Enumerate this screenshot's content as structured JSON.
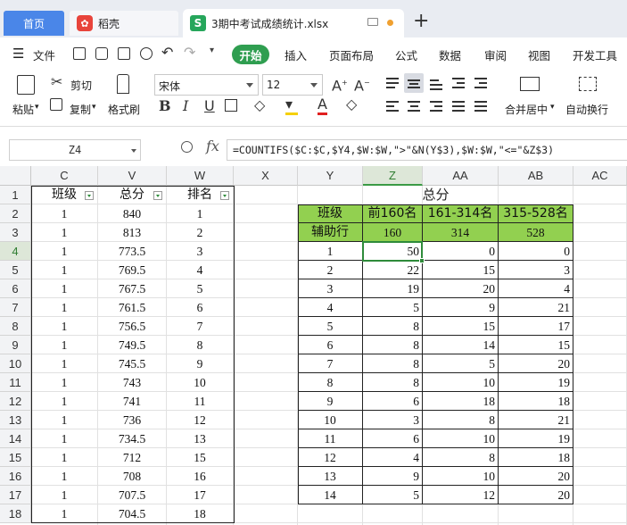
{
  "tabs": {
    "home": "首页",
    "docer": "稻壳",
    "file": "3期中考试成绩统计.xlsx",
    "new_tab": "+"
  },
  "menu": {
    "file": "文件",
    "start": "开始",
    "insert": "插入",
    "page_layout": "页面布局",
    "formula": "公式",
    "data": "数据",
    "review": "审阅",
    "view": "视图",
    "dev_tools": "开发工具"
  },
  "ribbon": {
    "paste": "粘贴",
    "cut": "剪切",
    "copy": "复制",
    "format_painter": "格式刷",
    "font_name": "宋体",
    "font_size": "12",
    "merge_center": "合并居中",
    "wrap_text": "自动换行",
    "bold": "B",
    "italic": "I",
    "underline": "U"
  },
  "formula_bar": {
    "name_box": "Z4",
    "fx": "fx",
    "formula": "=COUNTIFS($C:$C,$Y4,$W:$W,\">\"&N(Y$3),$W:$W,\"<=\"&Z$3)"
  },
  "columns": [
    "C",
    "V",
    "W",
    "X",
    "Y",
    "Z",
    "AA",
    "AB",
    "AC"
  ],
  "rows": [
    "1",
    "2",
    "3",
    "4",
    "5",
    "6",
    "7",
    "8",
    "9",
    "10",
    "11",
    "12",
    "13",
    "14",
    "15",
    "16",
    "17",
    "18"
  ],
  "left_table": {
    "headers": [
      "班级",
      "总分",
      "排名"
    ],
    "data": [
      [
        "1",
        "840",
        "1"
      ],
      [
        "1",
        "813",
        "2"
      ],
      [
        "1",
        "773.5",
        "3"
      ],
      [
        "1",
        "769.5",
        "4"
      ],
      [
        "1",
        "767.5",
        "5"
      ],
      [
        "1",
        "761.5",
        "6"
      ],
      [
        "1",
        "756.5",
        "7"
      ],
      [
        "1",
        "749.5",
        "8"
      ],
      [
        "1",
        "745.5",
        "9"
      ],
      [
        "1",
        "743",
        "10"
      ],
      [
        "1",
        "741",
        "11"
      ],
      [
        "1",
        "736",
        "12"
      ],
      [
        "1",
        "734.5",
        "13"
      ],
      [
        "1",
        "712",
        "15"
      ],
      [
        "1",
        "708",
        "16"
      ],
      [
        "1",
        "707.5",
        "17"
      ],
      [
        "1",
        "704.5",
        "18"
      ]
    ]
  },
  "stats_table": {
    "title": "总分",
    "headers": [
      "班级",
      "前160名",
      "161-314名",
      "315-528名"
    ],
    "helper_label": "辅助行",
    "helper_values": [
      "160",
      "314",
      "528"
    ],
    "data": [
      [
        "1",
        "50",
        "0",
        "0"
      ],
      [
        "2",
        "22",
        "15",
        "3"
      ],
      [
        "3",
        "19",
        "20",
        "4"
      ],
      [
        "4",
        "5",
        "9",
        "21"
      ],
      [
        "5",
        "8",
        "15",
        "17"
      ],
      [
        "6",
        "8",
        "14",
        "15"
      ],
      [
        "7",
        "8",
        "5",
        "20"
      ],
      [
        "8",
        "8",
        "10",
        "19"
      ],
      [
        "9",
        "6",
        "18",
        "18"
      ],
      [
        "10",
        "3",
        "8",
        "21"
      ],
      [
        "11",
        "6",
        "10",
        "19"
      ],
      [
        "12",
        "4",
        "8",
        "18"
      ],
      [
        "13",
        "9",
        "10",
        "20"
      ],
      [
        "14",
        "5",
        "12",
        "20"
      ]
    ]
  },
  "colors": {
    "accent": "#2f9e50",
    "header_fill": "#92d050",
    "tab_active": "#4a86e8"
  }
}
